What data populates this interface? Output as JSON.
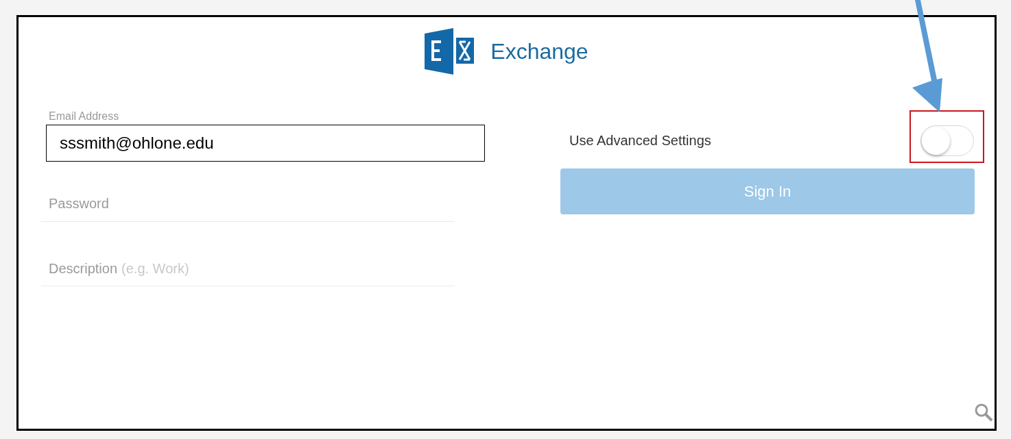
{
  "logo": {
    "title": "Exchange"
  },
  "email": {
    "label": "Email Address",
    "value": "sssmith@ohlone.edu"
  },
  "password": {
    "placeholder": "Password"
  },
  "description": {
    "placeholder": "Description",
    "hint": "(e.g. Work)"
  },
  "advanced": {
    "label": "Use Advanced Settings",
    "on": false,
    "highlighted": true
  },
  "sign_in": {
    "label": "Sign In",
    "disabled": true
  }
}
